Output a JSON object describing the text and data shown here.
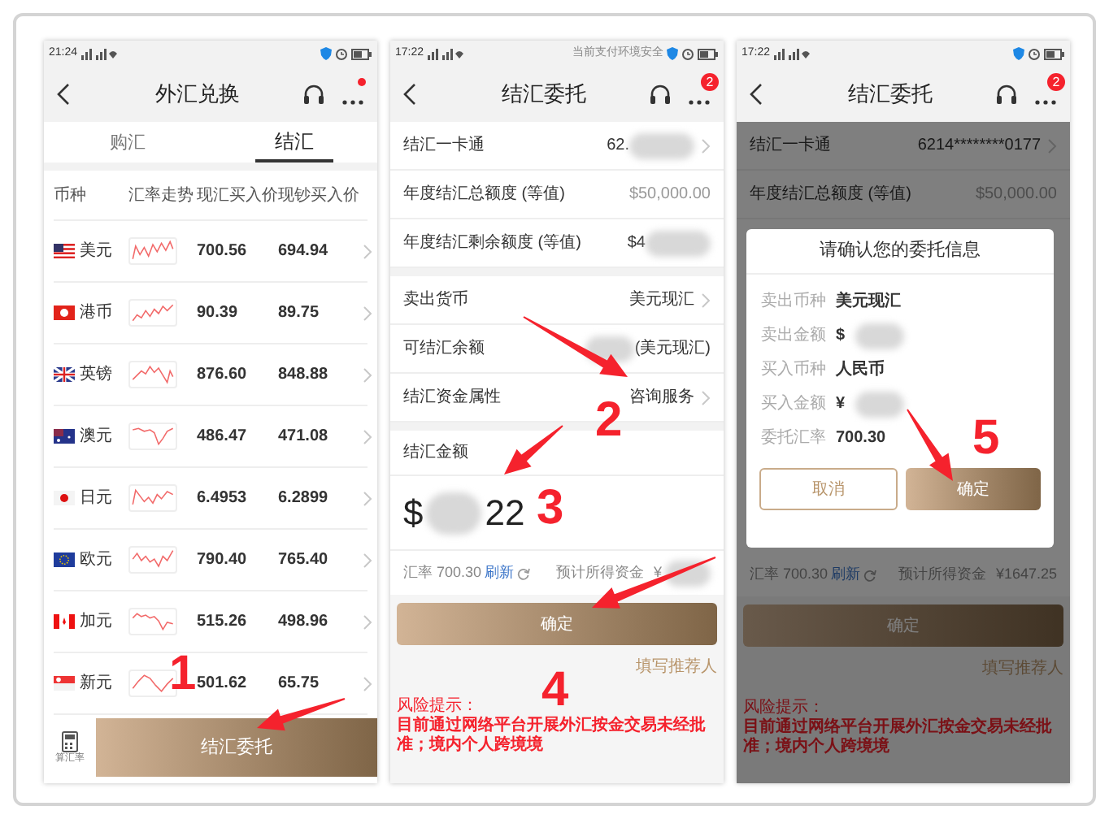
{
  "screen_1": {
    "status_time": "21:24",
    "title": "外汇兑换",
    "tabs": [
      {
        "label": "购汇",
        "selected": false
      },
      {
        "label": "结汇",
        "selected": true
      }
    ],
    "columns": [
      "币种",
      "汇率走势",
      "现汇买入价",
      "现钞买入价"
    ],
    "rows": [
      {
        "currency": "美元",
        "spot_buy": "700.56",
        "cash_buy": "694.94"
      },
      {
        "currency": "港币",
        "spot_buy": "90.39",
        "cash_buy": "89.75"
      },
      {
        "currency": "英镑",
        "spot_buy": "876.60",
        "cash_buy": "848.88"
      },
      {
        "currency": "澳元",
        "spot_buy": "486.47",
        "cash_buy": "471.08"
      },
      {
        "currency": "日元",
        "spot_buy": "6.4953",
        "cash_buy": "6.2899"
      },
      {
        "currency": "欧元",
        "spot_buy": "790.40",
        "cash_buy": "765.40"
      },
      {
        "currency": "加元",
        "spot_buy": "515.26",
        "cash_buy": "498.96"
      },
      {
        "currency": "新元",
        "spot_buy": "501.62",
        "cash_buy": "65.75"
      }
    ],
    "calculator_label": "算汇率",
    "button": "结汇委托"
  },
  "screen_2": {
    "status_time": "17:22",
    "status_note": "当前支付环境安全",
    "title": "结汇委托",
    "badge": "2",
    "account_rows": [
      {
        "label": "结汇一卡通",
        "value": "62.",
        "blur_after": true,
        "chevron": true
      },
      {
        "label": "年度结汇总额度 (等值)",
        "value": "$50,000.00",
        "chevron": false
      },
      {
        "label": "年度结汇剩余额度 (等值)",
        "value": "$4",
        "blur_after": true,
        "chevron": false
      }
    ],
    "sale_rows": [
      {
        "label": "卖出货币",
        "value": "美元现汇",
        "chevron": true
      },
      {
        "label": "可结汇余额",
        "value": "(美元现汇)",
        "blur_before": true,
        "chevron": false
      },
      {
        "label": "结汇资金属性",
        "value": "咨询服务",
        "chevron": true
      }
    ],
    "amount_label": "结汇金额",
    "amount_prefix": "$",
    "amount_suffix": "22",
    "rate": "汇率 700.30",
    "refresh": "刷新",
    "estimate_label": "预计所得资金",
    "estimate_value": "¥",
    "estimate_blurred": true,
    "confirm": "确定",
    "referrer": "填写推荐人",
    "risk_title": "风险提示：",
    "risk_text": "目前通过网络平台开展外汇按金交易未经批准；境内个人跨境境"
  },
  "screen_3": {
    "status_time": "17:22",
    "title": "结汇委托",
    "badge": "2",
    "account_rows": [
      {
        "label": "结汇一卡通",
        "value": "6214********0177",
        "chevron": true
      },
      {
        "label": "年度结汇总额度 (等值)",
        "value": "$50,000.00",
        "chevron": false
      }
    ],
    "dialog": {
      "title": "请确认您的委托信息",
      "fields": [
        {
          "label": "卖出币种",
          "value": "美元现汇"
        },
        {
          "label": "卖出金额",
          "value": "$",
          "blur_after": true
        },
        {
          "label": "买入币种",
          "value": "人民币"
        },
        {
          "label": "买入金额",
          "value": "¥",
          "blur_after": true
        },
        {
          "label": "委托汇率",
          "value": "700.30"
        }
      ],
      "buttons": [
        {
          "label": "取消",
          "kind": "secondary"
        },
        {
          "label": "确定",
          "kind": "primary"
        }
      ]
    },
    "rate": "汇率 700.30",
    "refresh": "刷新",
    "estimate_label": "预计所得资金",
    "estimate_value": "¥1647.25",
    "confirm": "确定",
    "referrer": "填写推荐人",
    "risk_title": "风险提示：",
    "risk_text": "目前通过网络平台开展外汇按金交易未经批准；境内个人跨境境"
  },
  "annotations": [
    {
      "label": "1"
    },
    {
      "label": "2"
    },
    {
      "label": "3"
    },
    {
      "label": "4"
    },
    {
      "label": "5"
    }
  ]
}
